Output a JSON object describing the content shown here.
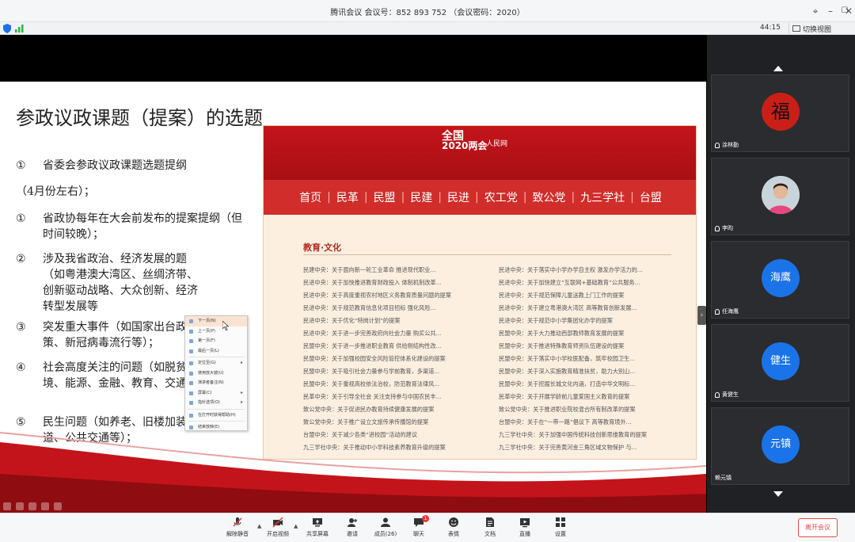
{
  "window": {
    "title": "腾讯会议 会议号：852 893 752  （会议密码：2020）"
  },
  "status": {
    "timer": "44:15",
    "switch_view": "切换视图"
  },
  "slide": {
    "title": "参政议政课题（提案）的选题",
    "items": [
      {
        "num": "①",
        "text": "省委会参政议政课题选题提纲"
      },
      {
        "num": "",
        "text": "（4月份左右）；"
      },
      {
        "num": "①",
        "text": "省政协每年在大会前发布的提案提纲（但时间较晚）；"
      },
      {
        "num": "②",
        "text": "涉及我省政治、经济发展的题（如粤港澳大湾区、丝绸济带、创新驱动战略、大众创新、经济转型发展等"
      },
      {
        "num": "③",
        "text": "突发重大事件（如国家出台政策、新冠病毒流行等）；"
      },
      {
        "num": "④",
        "text": "社会高度关注的问题（如脱贫攻坚、环境、能源、金融、教育、交通、就业等）；"
      },
      {
        "num": "⑤",
        "text": "民生问题（如养老、旧楼加装电梯、绿道、公共交通等）；"
      }
    ]
  },
  "news": {
    "logo_line1": "全国",
    "logo_line2": "2020两会",
    "logo_brand": "人民网",
    "nav": [
      "首页",
      "民革",
      "民盟",
      "民建",
      "民进",
      "农工党",
      "致公党",
      "九三学社",
      "台盟"
    ],
    "section": "教育·文化",
    "left_col": [
      "民建中央：关于面向新一轮工业革命 推进现代职业...",
      "民进中央：关于加快推进教育财政投入 体制机制改革...",
      "民进中央：关于高度重视农村地区义务教育质量问题的提案",
      "民进中央：关于规范教育信息化项目招标 强化风险...",
      "民进中央：关于优化“特岗计划”的提案",
      "民进中央：关于进一步完善政府向社会力量 购买公共...",
      "民盟中央：关于进一步推进职业教育 供给侧结构性改...",
      "民盟中央：关于加强校园安全风险管控体系化建设的提案",
      "民盟中央：关于吸引社会力量参与学前教育，多渠道...",
      "民盟中央：关于重视高校依法治校，防范教育法律风...",
      "民革中央：关于引导全社会 关注支持参与中国农民丰...",
      "致公党中央：关于促进民办教育持续健康发展的提案",
      "致公党中央：关于推广设立文旅传承传播馆的提案",
      "台盟中央：关于减少各类“进校园”活动的建议",
      "九三学社中央：关于推动中小学科技素养教育升级的提案"
    ],
    "right_col": [
      "民进中央：关于落实中小学办学自主权 激发办学活力的...",
      "民进中央：关于加快建立“互联网+基础教育”公共服务...",
      "民进中央：关于规范保障儿童送教上门工作的提案",
      "民进中央：关于建立粤港澳大湾区 高等教育创新发展...",
      "民进中央：关于规范中小学集团化办学的提案",
      "民盟中央：关于大力推动西部教师教育发展的提案",
      "民盟中央：关于推进特殊教育师资队伍建设的提案",
      "民盟中央：关于落实中小学校医配备，筑牢校园卫生...",
      "民盟中央：关于深入实施教育精准扶贫，助力大别山...",
      "民盟中央：关于挖掘长城文化内涵，打造中华文明标...",
      "民革中央：关于开展学龄前儿童爱国主义教育的提案",
      "致公党中央：关于推进职业院校混合所有制改革的提案",
      "台盟中央：关于在“一带一路”倡议下 高等教育境外...",
      "九三学社中央：关于加强中国传统科技创新思维教育的提案",
      "九三学社中央：关于完善黄河金三角区域文物保护 与..."
    ]
  },
  "context_menu": [
    {
      "label": "下一页(N)",
      "selected": true,
      "arrow": false
    },
    {
      "label": "上一页(P)",
      "selected": false,
      "arrow": false
    },
    {
      "label": "第一页(F)",
      "selected": false,
      "arrow": false
    },
    {
      "label": "最后一页(L)",
      "selected": false,
      "arrow": false
    },
    {
      "label": "定位至(G)",
      "selected": false,
      "arrow": true
    },
    {
      "label": "使用放大镜(U)",
      "selected": false,
      "arrow": false
    },
    {
      "label": "演讲者备注(N)",
      "selected": false,
      "arrow": false
    },
    {
      "label": "屏幕(C)",
      "selected": false,
      "arrow": true
    },
    {
      "label": "指针选项(O)",
      "selected": false,
      "arrow": true
    },
    {
      "label": "在打开时获得帮助(H)",
      "selected": false,
      "arrow": false
    },
    {
      "label": "结束放映(E)",
      "selected": false,
      "arrow": false
    }
  ],
  "participants": [
    {
      "name": "涂林勤",
      "avatar_text": "福",
      "type": "fu"
    },
    {
      "name": "李昀",
      "avatar_text": "",
      "type": "photo"
    },
    {
      "name": "任海鹰",
      "avatar_text": "海鹰",
      "type": "initials"
    },
    {
      "name": "黄健生",
      "avatar_text": "健生",
      "type": "initials"
    },
    {
      "name": "赖元镇",
      "avatar_text": "元镇",
      "type": "initials"
    }
  ],
  "toolbar": {
    "mute": "解除静音",
    "video": "开启视频",
    "share": "共享屏幕",
    "invite": "邀请",
    "members": "成员(26)",
    "chat": "聊天",
    "chat_badge": "1",
    "reactions": "表情",
    "docs": "文档",
    "live": "直播",
    "settings": "设置",
    "leave": "离开会议"
  },
  "colors": {
    "accent_red": "#c4141b",
    "avatar_blue": "#1a73e8",
    "leave_red": "#e34a4a"
  }
}
